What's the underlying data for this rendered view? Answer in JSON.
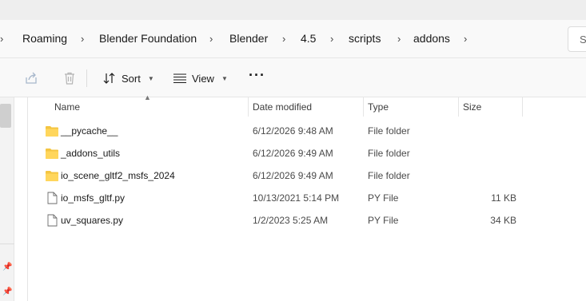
{
  "breadcrumb": [
    "Roaming",
    "Blender Foundation",
    "Blender",
    "4.5",
    "scripts",
    "addons"
  ],
  "search": {
    "label": "S"
  },
  "toolbar": {
    "sort_label": "Sort",
    "view_label": "View",
    "more_label": "···"
  },
  "columns": {
    "name": "Name",
    "date": "Date modified",
    "type": "Type",
    "size": "Size"
  },
  "files": [
    {
      "name": "__pycache__",
      "date": "6/12/2026 9:48 AM",
      "type": "File folder",
      "size": "",
      "icon": "folder-icon"
    },
    {
      "name": "_addons_utils",
      "date": "6/12/2026 9:49 AM",
      "type": "File folder",
      "size": "",
      "icon": "folder-icon"
    },
    {
      "name": "io_scene_gltf2_msfs_2024",
      "date": "6/12/2026 9:49 AM",
      "type": "File folder",
      "size": "",
      "icon": "folder-icon"
    },
    {
      "name": "io_msfs_gltf.py",
      "date": "10/13/2021 5:14 PM",
      "type": "PY File",
      "size": "11 KB",
      "icon": "file-icon"
    },
    {
      "name": "uv_squares.py",
      "date": "1/2/2023 5:25 AM",
      "type": "PY File",
      "size": "34 KB",
      "icon": "file-icon"
    }
  ],
  "colors": {
    "folder": "#f4c542",
    "accent": "#0067c0"
  }
}
